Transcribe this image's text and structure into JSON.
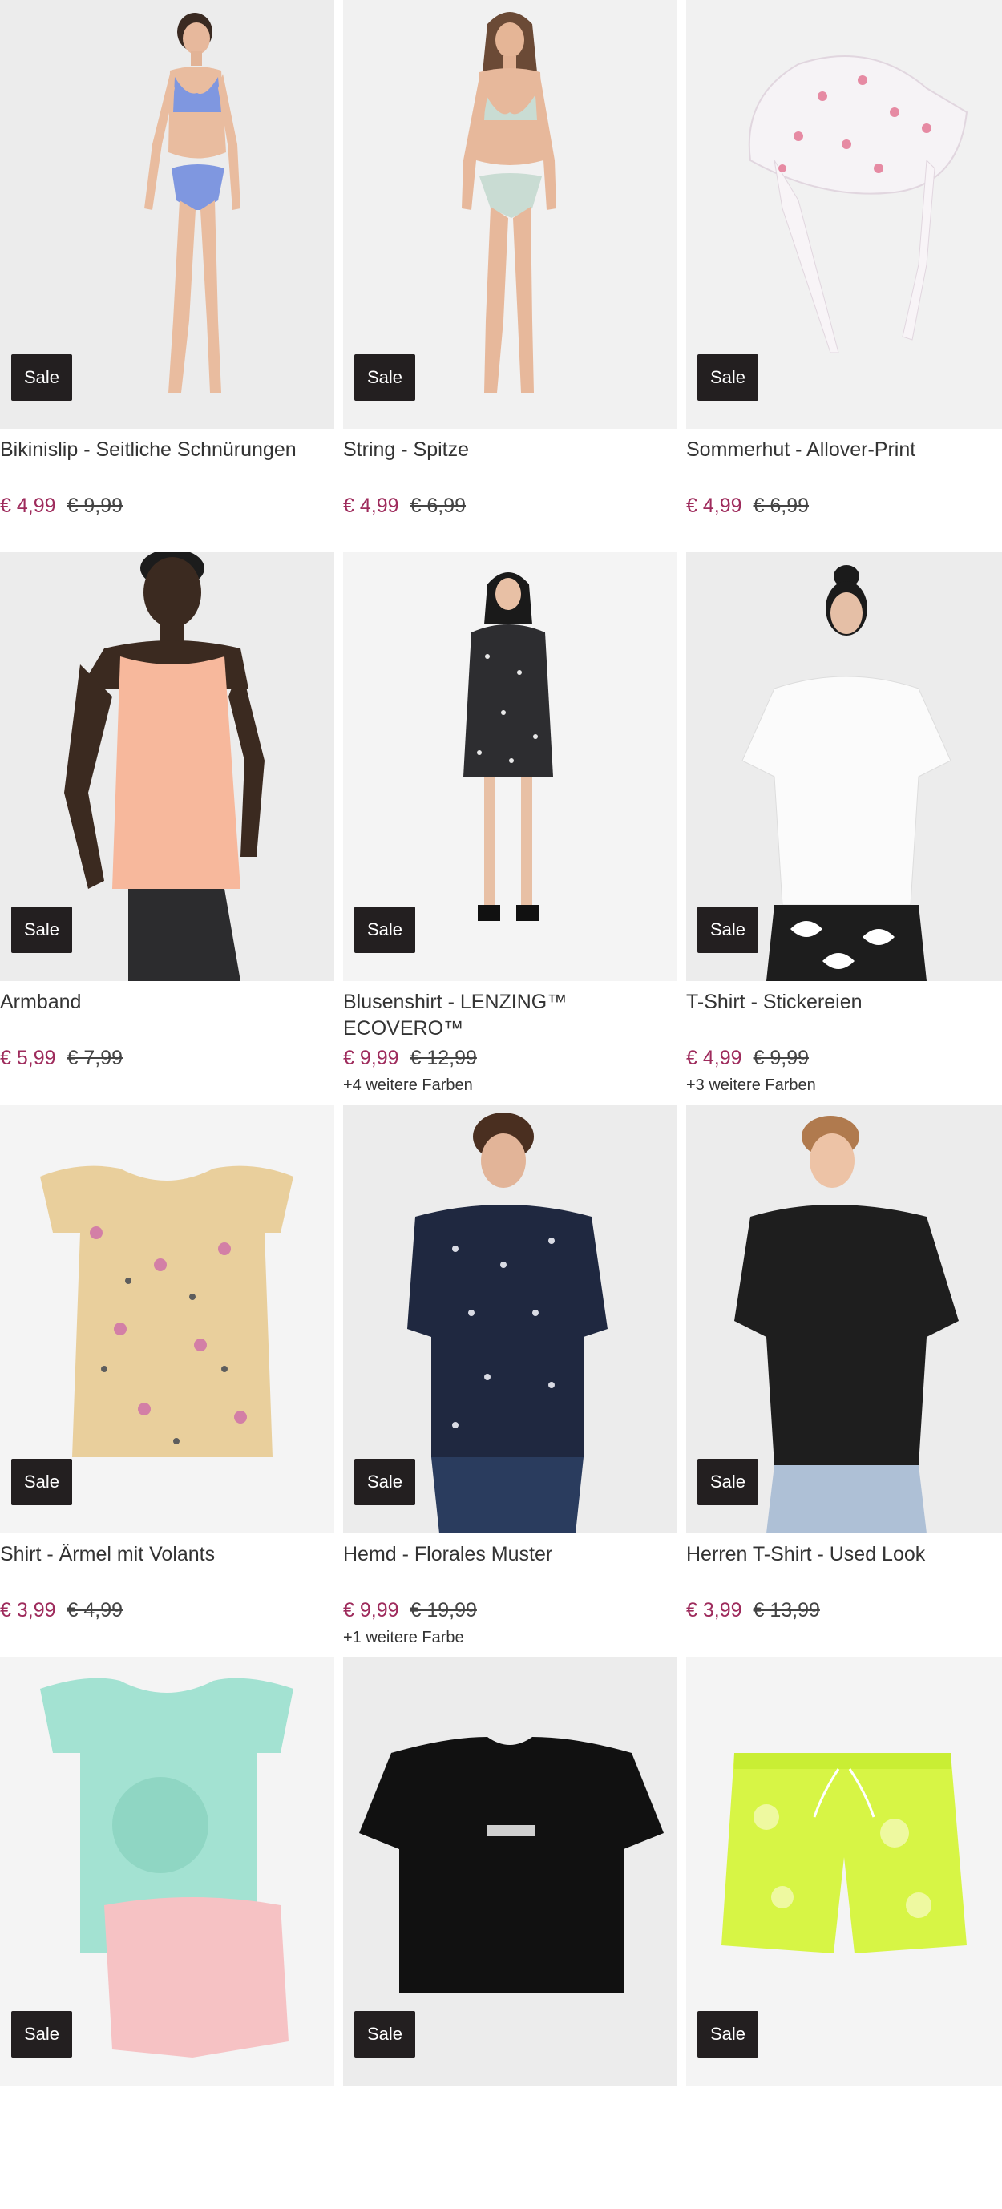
{
  "products": [
    {
      "title": "Bikinislip - Seitliche Schnürungen",
      "price": "€ 4,99",
      "old_price": "€ 9,99",
      "badge": "Sale",
      "more": ""
    },
    {
      "title": "String - Spitze",
      "price": "€ 4,99",
      "old_price": "€ 6,99",
      "badge": "Sale",
      "more": ""
    },
    {
      "title": "Sommerhut - Allover-Print",
      "price": "€ 4,99",
      "old_price": "€ 6,99",
      "badge": "Sale",
      "more": ""
    },
    {
      "title": "Armband",
      "price": "€ 5,99",
      "old_price": "€ 7,99",
      "badge": "Sale",
      "more": ""
    },
    {
      "title": "Blusenshirt - LENZING™ ECOVERO™",
      "price": "€ 9,99",
      "old_price": "€ 12,99",
      "badge": "Sale",
      "more": "+4 weitere Farben"
    },
    {
      "title": "T-Shirt - Stickereien",
      "price": "€ 4,99",
      "old_price": "€ 9,99",
      "badge": "Sale",
      "more": "+3 weitere Farben"
    },
    {
      "title": "Shirt - Ärmel mit Volants",
      "price": "€ 3,99",
      "old_price": "€ 4,99",
      "badge": "Sale",
      "more": ""
    },
    {
      "title": "Hemd - Florales Muster",
      "price": "€ 9,99",
      "old_price": "€ 19,99",
      "badge": "Sale",
      "more": "+1 weitere Farbe"
    },
    {
      "title": "Herren T-Shirt - Used Look",
      "price": "€ 3,99",
      "old_price": "€ 13,99",
      "badge": "Sale",
      "more": ""
    },
    {
      "title": "",
      "price": "",
      "old_price": "",
      "badge": "Sale",
      "more": ""
    },
    {
      "title": "",
      "price": "",
      "old_price": "",
      "badge": "Sale",
      "more": ""
    },
    {
      "title": "",
      "price": "",
      "old_price": "",
      "badge": "Sale",
      "more": ""
    }
  ],
  "colors": {
    "sale_price": "#9e2b5c",
    "badge_bg": "#231f20"
  }
}
